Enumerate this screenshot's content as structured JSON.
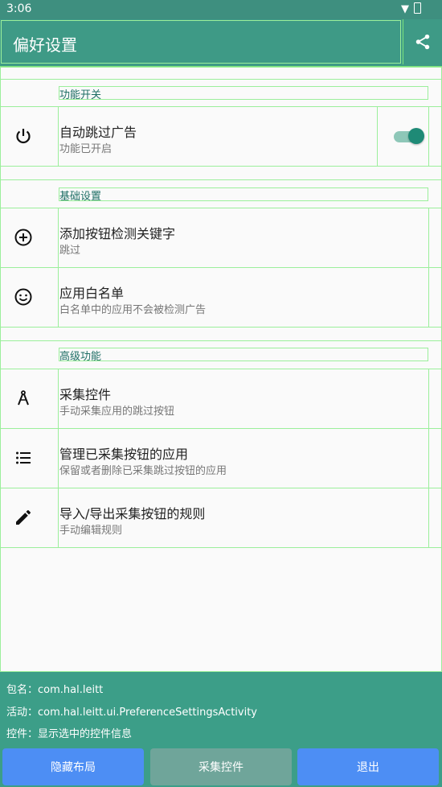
{
  "status": {
    "time": "3:06"
  },
  "appbar": {
    "title": "偏好设置"
  },
  "categories": [
    {
      "title": "功能开关"
    },
    {
      "title": "基础设置"
    },
    {
      "title": "高级功能"
    }
  ],
  "items": [
    {
      "title": "自动跳过广告",
      "summary": "功能已开启",
      "icon": "power-icon",
      "toggle": true
    },
    {
      "title": "添加按钮检测关键字",
      "summary": "跳过",
      "icon": "add-circle-icon"
    },
    {
      "title": "应用白名单",
      "summary": "白名单中的应用不会被检测广告",
      "icon": "smiley-icon"
    },
    {
      "title": "采集控件",
      "summary": "手动采集应用的跳过按钮",
      "icon": "compass-icon"
    },
    {
      "title": "管理已采集按钮的应用",
      "summary": "保留或者删除已采集跳过按钮的应用",
      "icon": "list-icon"
    },
    {
      "title": "导入/导出采集按钮的规则",
      "summary": "手动编辑规则",
      "icon": "pencil-icon"
    }
  ],
  "panel": {
    "package_line": "包名：com.hal.leitt",
    "activity_line": "活动：com.hal.leitt.ui.PreferenceSettingsActivity",
    "widget_line": "控件：显示选中的控件信息",
    "buttons": {
      "hide": "隐藏布局",
      "collect": "采集控件",
      "exit": "退出"
    }
  },
  "colors": {
    "appbar": "#3e9a86",
    "accent": "#1e8a76",
    "panel": "#3c9e88",
    "button_blue": "#4d8ef4"
  }
}
